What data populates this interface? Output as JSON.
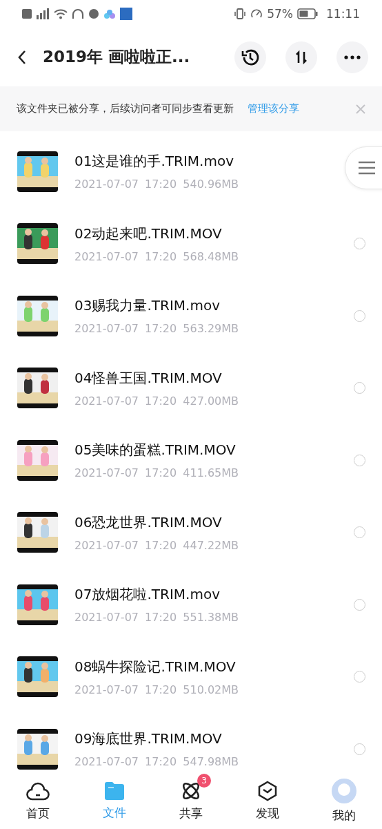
{
  "status_bar": {
    "battery": "57%",
    "time": "11:11"
  },
  "header": {
    "title": "2019年  画啦啦正..."
  },
  "share_banner": {
    "message": "该文件夹已被分享，后续访问者可同步查看更新",
    "link": "管理该分享"
  },
  "files": [
    {
      "name": "01这是谁的手.TRIM.mov",
      "date": "2021-07-07",
      "time": "17:20",
      "size": "540.96MB"
    },
    {
      "name": "02动起来吧.TRIM.MOV",
      "date": "2021-07-07",
      "time": "17:20",
      "size": "568.48MB",
      "selected": false
    },
    {
      "name": "03赐我力量.TRIM.mov",
      "date": "2021-07-07",
      "time": "17:20",
      "size": "563.29MB",
      "selected": false
    },
    {
      "name": "04怪兽王国.TRIM.MOV",
      "date": "2021-07-07",
      "time": "17:20",
      "size": "427.00MB",
      "selected": false
    },
    {
      "name": "05美味的蛋糕.TRIM.MOV",
      "date": "2021-07-07",
      "time": "17:20",
      "size": "411.65MB",
      "selected": false
    },
    {
      "name": "06恐龙世界.TRIM.MOV",
      "date": "2021-07-07",
      "time": "17:20",
      "size": "447.22MB",
      "selected": false
    },
    {
      "name": "07放烟花啦.TRIM.mov",
      "date": "2021-07-07",
      "time": "17:20",
      "size": "551.38MB",
      "selected": false
    },
    {
      "name": "08蜗牛探险记.TRIM.MOV",
      "date": "2021-07-07",
      "time": "17:20",
      "size": "510.02MB",
      "selected": false
    },
    {
      "name": "09海底世界.TRIM.MOV",
      "date": "2021-07-07",
      "time": "17:20",
      "size": "547.98MB",
      "selected": false
    }
  ],
  "tabs": [
    {
      "label": "首页",
      "kind": "home",
      "selected": false
    },
    {
      "label": "文件",
      "kind": "files",
      "selected": true
    },
    {
      "label": "共享",
      "kind": "share",
      "selected": false,
      "badge": "3"
    },
    {
      "label": "发现",
      "kind": "discover",
      "selected": false
    },
    {
      "label": "我的",
      "kind": "me",
      "selected": false
    }
  ]
}
